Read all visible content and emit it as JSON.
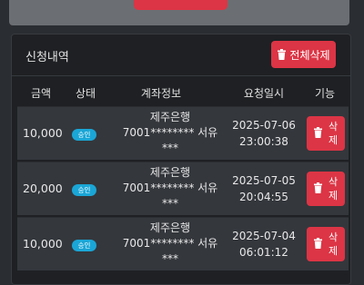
{
  "panel": {
    "title": "신청내역",
    "delete_all_label": "전체삭제"
  },
  "table": {
    "headers": [
      "금액",
      "상태",
      "계좌정보",
      "요청일시",
      "기능"
    ],
    "rows": [
      {
        "amount": "10,000",
        "status": "승인",
        "bank": "제주은행",
        "account": "7001******** 서유 ***",
        "date": "2025-07-06",
        "time": "23:00:38",
        "action": "삭제"
      },
      {
        "amount": "20,000",
        "status": "승인",
        "bank": "제주은행",
        "account": "7001******** 서유 ***",
        "date": "2025-07-05",
        "time": "20:04:55",
        "action": "삭제"
      },
      {
        "amount": "10,000",
        "status": "승인",
        "bank": "제주은행",
        "account": "7001******** 서유 ***",
        "date": "2025-07-04",
        "time": "06:01:12",
        "action": "삭제"
      }
    ]
  },
  "colors": {
    "accent_red": "#dc3545",
    "badge_blue": "#1aa6d6",
    "panel_bg": "#1e2023",
    "row_bg": "#34373c"
  },
  "icons": {
    "trash": "trash-icon"
  }
}
